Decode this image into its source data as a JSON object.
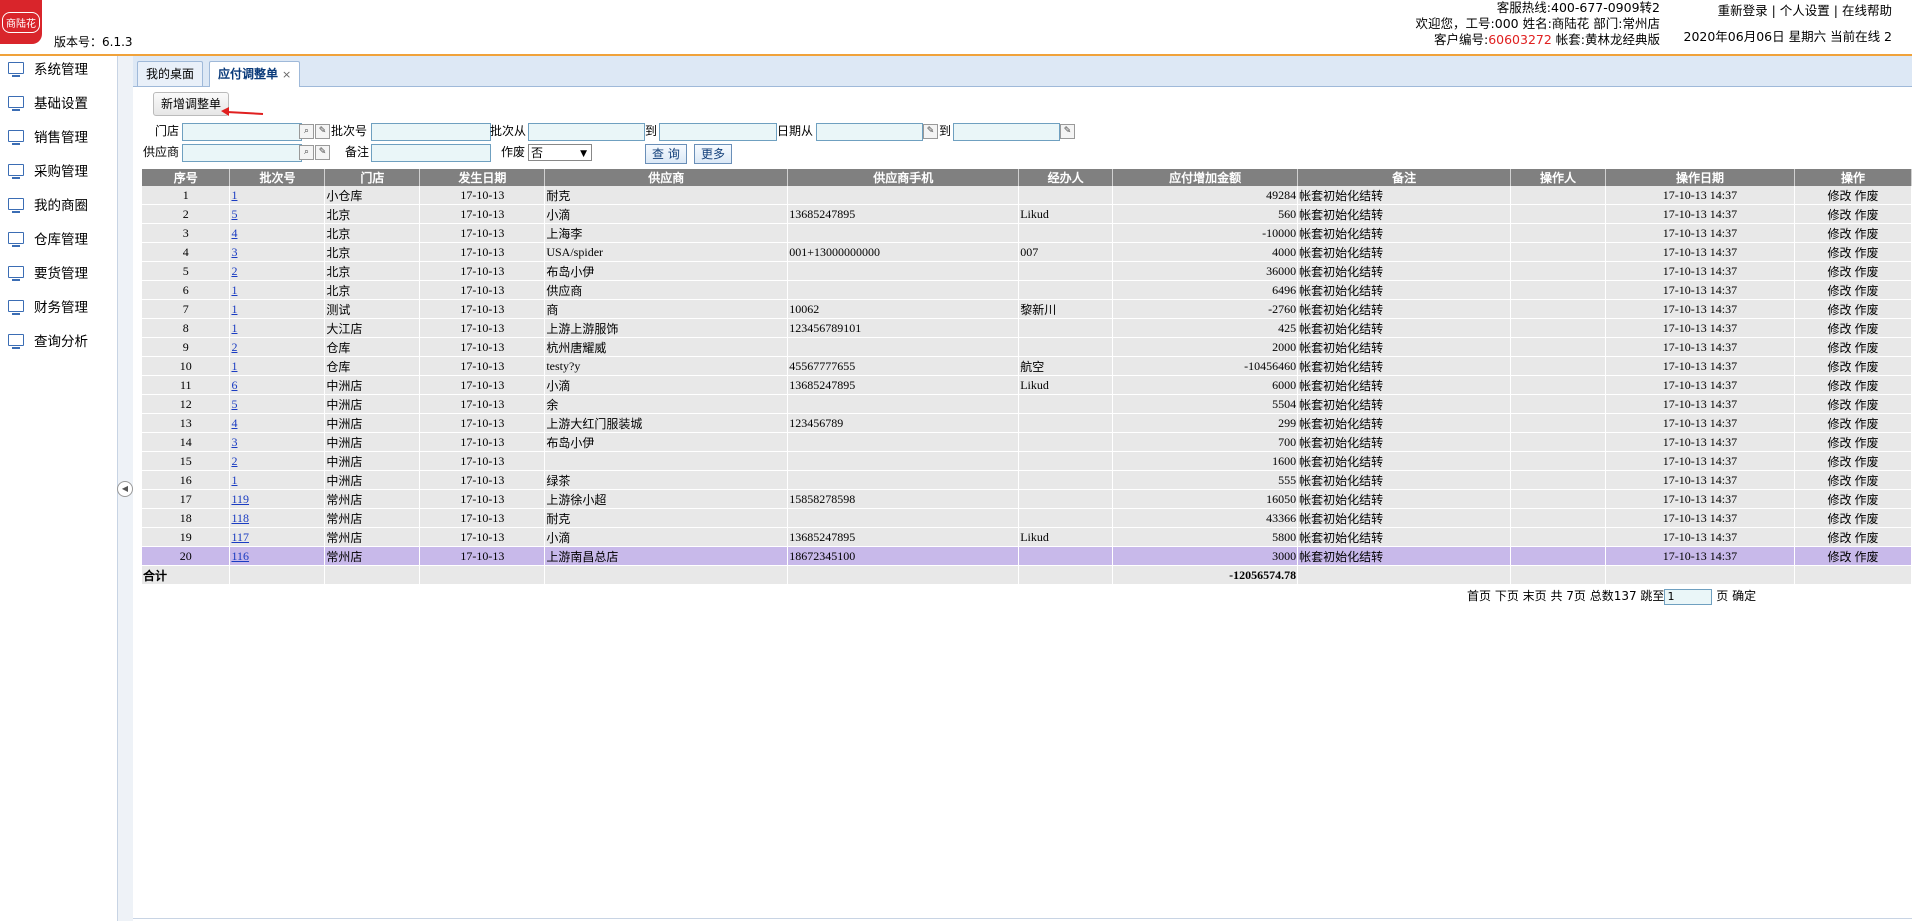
{
  "header": {
    "logo_text": "商陆花",
    "version": "版本号：6.1.3",
    "hotline": "客服热线:400-677-0909转2",
    "welcome": "欢迎您，工号:000 姓名:商陆花 部门:常州店",
    "customer_prefix": "客户编号:",
    "customer_no": "60603272",
    "account": " 帐套:黄林龙经典版",
    "links": {
      "relogin": "重新登录",
      "sep1": " | ",
      "settings": "个人设置",
      "sep2": " | ",
      "help": "在线帮助"
    },
    "date": "2020年06月06日 星期六 当前在线 2"
  },
  "sidebar": {
    "items": [
      "系统管理",
      "基础设置",
      "销售管理",
      "采购管理",
      "我的商圈",
      "仓库管理",
      "要货管理",
      "财务管理",
      "查询分析"
    ]
  },
  "tabs": {
    "desktop": "我的桌面",
    "active": "应付调整单",
    "close": "×"
  },
  "toolbar": {
    "add": "新增调整单"
  },
  "filters": {
    "store": "门店",
    "batch": "批次号",
    "batch_from": "批次从",
    "to1": "到",
    "date_from": "日期从",
    "to2": "到",
    "supplier": "供应商",
    "remark": "备注",
    "void": "作废",
    "void_value": "否",
    "query": "查 询",
    "more": "更多"
  },
  "columns": [
    "序号",
    "批次号",
    "门店",
    "发生日期",
    "供应商",
    "供应商手机",
    "经办人",
    "应付增加金额",
    "备注",
    "操作人",
    "操作日期",
    "操作"
  ],
  "rows": [
    {
      "no": "1",
      "batch": "1",
      "store": "小仓库",
      "date": "17-10-13",
      "supplier": "耐克",
      "phone": "",
      "handler": "",
      "amount": "49284",
      "remark": "帐套初始化结转",
      "operator": "",
      "op_date": "17-10-13 14:37",
      "edit": "修改",
      "void": "作废"
    },
    {
      "no": "2",
      "batch": "5",
      "store": "北京",
      "date": "17-10-13",
      "supplier": "小滴",
      "phone": "13685247895",
      "handler": "Likud",
      "amount": "560",
      "remark": "帐套初始化结转",
      "operator": "",
      "op_date": "17-10-13 14:37",
      "edit": "修改",
      "void": "作废"
    },
    {
      "no": "3",
      "batch": "4",
      "store": "北京",
      "date": "17-10-13",
      "supplier": "上海李",
      "phone": "",
      "handler": "",
      "amount": "-10000",
      "remark": "帐套初始化结转",
      "operator": "",
      "op_date": "17-10-13 14:37",
      "edit": "修改",
      "void": "作废"
    },
    {
      "no": "4",
      "batch": "3",
      "store": "北京",
      "date": "17-10-13",
      "supplier": "USA/spider",
      "phone": "001+13000000000",
      "handler": "007",
      "amount": "4000",
      "remark": "帐套初始化结转",
      "operator": "",
      "op_date": "17-10-13 14:37",
      "edit": "修改",
      "void": "作废"
    },
    {
      "no": "5",
      "batch": "2",
      "store": "北京",
      "date": "17-10-13",
      "supplier": "布岛小伊",
      "phone": "",
      "handler": "",
      "amount": "36000",
      "remark": "帐套初始化结转",
      "operator": "",
      "op_date": "17-10-13 14:37",
      "edit": "修改",
      "void": "作废"
    },
    {
      "no": "6",
      "batch": "1",
      "store": "北京",
      "date": "17-10-13",
      "supplier": "供应商",
      "phone": "",
      "handler": "",
      "amount": "6496",
      "remark": "帐套初始化结转",
      "operator": "",
      "op_date": "17-10-13 14:37",
      "edit": "修改",
      "void": "作废"
    },
    {
      "no": "7",
      "batch": "1",
      "store": "测试",
      "date": "17-10-13",
      "supplier": "商",
      "phone": "10062",
      "handler": "黎新川",
      "amount": "-2760",
      "remark": "帐套初始化结转",
      "operator": "",
      "op_date": "17-10-13 14:37",
      "edit": "修改",
      "void": "作废"
    },
    {
      "no": "8",
      "batch": "1",
      "store": "大江店",
      "date": "17-10-13",
      "supplier": "上游上游服饰",
      "phone": "123456789101",
      "handler": "",
      "amount": "425",
      "remark": "帐套初始化结转",
      "operator": "",
      "op_date": "17-10-13 14:37",
      "edit": "修改",
      "void": "作废"
    },
    {
      "no": "9",
      "batch": "2",
      "store": "仓库",
      "date": "17-10-13",
      "supplier": "杭州唐耀威",
      "phone": "",
      "handler": "",
      "amount": "2000",
      "remark": "帐套初始化结转",
      "operator": "",
      "op_date": "17-10-13 14:37",
      "edit": "修改",
      "void": "作废"
    },
    {
      "no": "10",
      "batch": "1",
      "store": "仓库",
      "date": "17-10-13",
      "supplier": "testy?y",
      "phone": "45567777655",
      "handler": "航空",
      "amount": "-10456460",
      "remark": "帐套初始化结转",
      "operator": "",
      "op_date": "17-10-13 14:37",
      "edit": "修改",
      "void": "作废"
    },
    {
      "no": "11",
      "batch": "6",
      "store": "中洲店",
      "date": "17-10-13",
      "supplier": "小滴",
      "phone": "13685247895",
      "handler": "Likud",
      "amount": "6000",
      "remark": "帐套初始化结转",
      "operator": "",
      "op_date": "17-10-13 14:37",
      "edit": "修改",
      "void": "作废"
    },
    {
      "no": "12",
      "batch": "5",
      "store": "中洲店",
      "date": "17-10-13",
      "supplier": "余",
      "phone": "",
      "handler": "",
      "amount": "5504",
      "remark": "帐套初始化结转",
      "operator": "",
      "op_date": "17-10-13 14:37",
      "edit": "修改",
      "void": "作废"
    },
    {
      "no": "13",
      "batch": "4",
      "store": "中洲店",
      "date": "17-10-13",
      "supplier": "上游大红门服装城",
      "phone": "123456789",
      "handler": "",
      "amount": "299",
      "remark": "帐套初始化结转",
      "operator": "",
      "op_date": "17-10-13 14:37",
      "edit": "修改",
      "void": "作废"
    },
    {
      "no": "14",
      "batch": "3",
      "store": "中洲店",
      "date": "17-10-13",
      "supplier": "布岛小伊",
      "phone": "",
      "handler": "",
      "amount": "700",
      "remark": "帐套初始化结转",
      "operator": "",
      "op_date": "17-10-13 14:37",
      "edit": "修改",
      "void": "作废"
    },
    {
      "no": "15",
      "batch": "2",
      "store": "中洲店",
      "date": "17-10-13",
      "supplier": "",
      "phone": "",
      "handler": "",
      "amount": "1600",
      "remark": "帐套初始化结转",
      "operator": "",
      "op_date": "17-10-13 14:37",
      "edit": "修改",
      "void": "作废"
    },
    {
      "no": "16",
      "batch": "1",
      "store": "中洲店",
      "date": "17-10-13",
      "supplier": "绿茶",
      "phone": "",
      "handler": "",
      "amount": "555",
      "remark": "帐套初始化结转",
      "operator": "",
      "op_date": "17-10-13 14:37",
      "edit": "修改",
      "void": "作废"
    },
    {
      "no": "17",
      "batch": "119",
      "store": "常州店",
      "date": "17-10-13",
      "supplier": "上游徐小超",
      "phone": "15858278598",
      "handler": "",
      "amount": "16050",
      "remark": "帐套初始化结转",
      "operator": "",
      "op_date": "17-10-13 14:37",
      "edit": "修改",
      "void": "作废"
    },
    {
      "no": "18",
      "batch": "118",
      "store": "常州店",
      "date": "17-10-13",
      "supplier": "耐克",
      "phone": "",
      "handler": "",
      "amount": "43366",
      "remark": "帐套初始化结转",
      "operator": "",
      "op_date": "17-10-13 14:37",
      "edit": "修改",
      "void": "作废"
    },
    {
      "no": "19",
      "batch": "117",
      "store": "常州店",
      "date": "17-10-13",
      "supplier": "小滴",
      "phone": "13685247895",
      "handler": "Likud",
      "amount": "5800",
      "remark": "帐套初始化结转",
      "operator": "",
      "op_date": "17-10-13 14:37",
      "edit": "修改",
      "void": "作废"
    },
    {
      "no": "20",
      "batch": "116",
      "store": "常州店",
      "date": "17-10-13",
      "supplier": "上游南昌总店",
      "phone": "18672345100",
      "handler": "",
      "amount": "3000",
      "remark": "帐套初始化结转",
      "operator": "",
      "op_date": "17-10-13 14:37",
      "edit": "修改",
      "void": "作废"
    }
  ],
  "total": {
    "label": "合计",
    "amount": "-12056574.78"
  },
  "pager": {
    "text": "首页 下页 末页 共 7页 总数137 跳至",
    "page_value": "1",
    "suffix": "页 确定"
  },
  "colors": {
    "accent": "#f0a23a",
    "header_gray": "#808080",
    "row_bg": "#e8e8e8",
    "selected_row": "#c8b9ea",
    "link": "#1a3cc2",
    "logo_red": "#d9252b"
  }
}
